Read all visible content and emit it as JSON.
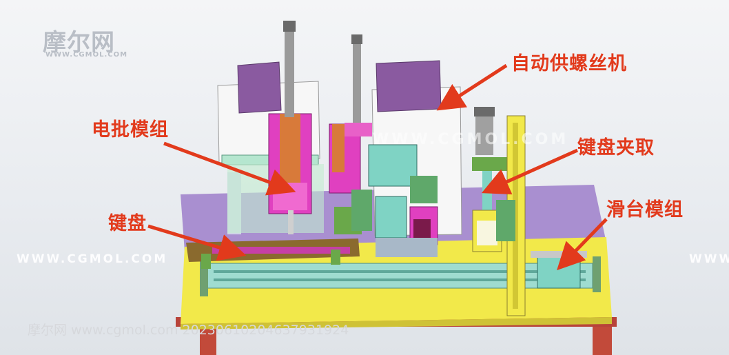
{
  "callouts": {
    "screw_feeder": "自动供螺丝机",
    "screwdriver_module": "电批模组",
    "keyboard_clamp": "键盘夹取",
    "slide_module": "滑台模组",
    "keyboard": "键盘"
  },
  "watermarks": {
    "logo": "摩尔网",
    "logo_sub": "WWW.CGMOL.COM",
    "url": "WWW.CGMOL.COM",
    "bottom": "摩尔网 www.cgmol.com 20230610204637931924"
  },
  "colors": {
    "callout_red": "#e23a1c",
    "table_yellow": "#f2e94a",
    "table_purple": "#a98fd0",
    "frame_red": "#c24a3a",
    "feeder_white": "#f7f7f7",
    "feeder_lid_purple": "#8a5aa0",
    "module_magenta": "#e040c0",
    "module_teal": "#7fd3c4",
    "rail_teal": "#9fdcd0",
    "keyboard_brown": "#8a6a2e"
  }
}
